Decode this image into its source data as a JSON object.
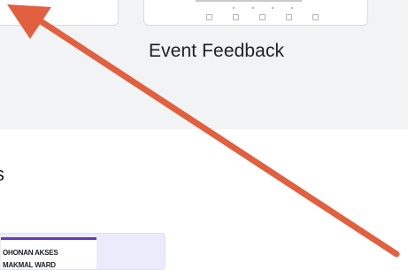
{
  "templates": {
    "right_card_name": "Event Feedback"
  },
  "section": {
    "heading_partial": "s"
  },
  "recent_doc": {
    "line1": "OHONAN AKSES",
    "line2": "MAKMAL WARD"
  },
  "colors": {
    "arrow": "#e06040",
    "gallery_bg": "#f1f3f4",
    "form_accent": "#673ab7"
  },
  "annotation": {
    "icon": "arrow-icon"
  }
}
